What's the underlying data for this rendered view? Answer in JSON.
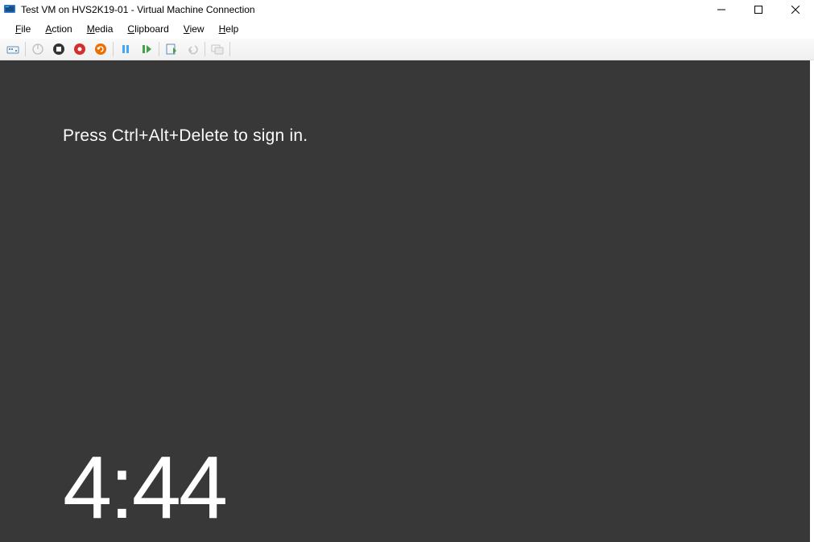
{
  "window": {
    "title": "Test VM on HVS2K19-01 - Virtual Machine Connection"
  },
  "menu": {
    "file": "File",
    "action": "Action",
    "media": "Media",
    "clipboard": "Clipboard",
    "view": "View",
    "help": "Help"
  },
  "toolbar": {
    "ctrl_alt_del": "ctrl-alt-del",
    "turn_off": "turn-off",
    "shut_down": "shut-down",
    "save": "save",
    "reset": "reset",
    "pause": "pause",
    "start": "start",
    "checkpoint": "checkpoint",
    "revert": "revert",
    "enhanced": "enhanced-session"
  },
  "lockscreen": {
    "message": "Press Ctrl+Alt+Delete to sign in.",
    "time": "4:44"
  }
}
